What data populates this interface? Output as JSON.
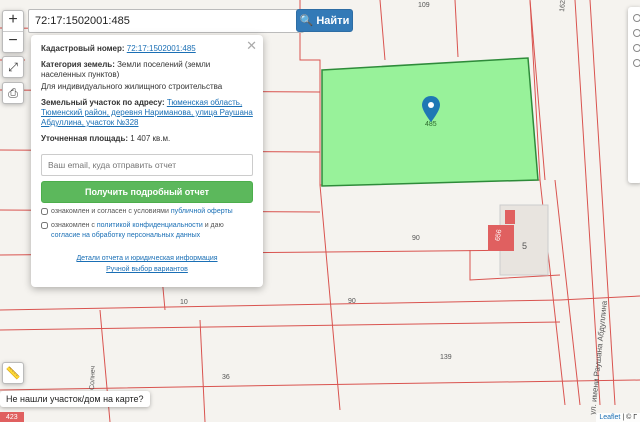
{
  "search": {
    "value": "72:17:1502001:485",
    "button_label": "Найти"
  },
  "zoom": {
    "in": "+",
    "out": "−"
  },
  "popup": {
    "cadastral_label": "Кадастровый номер:",
    "cadastral_value": "72:17:1502001:485",
    "category_label": "Категория земель:",
    "category_value": "Земли поселений (земли населенных пунктов)",
    "usage": "Для индивидуального жилищного строительства",
    "address_label": "Земельный участок по адресу:",
    "address_value": "Тюменская область, Тюменский район, деревня Нариманова, улица Раушана Абдуллина, участок №328",
    "area_label": "Уточненная площадь:",
    "area_value": "1 407 кв.м.",
    "email_placeholder": "Ваш email, куда отправить отчет",
    "report_button": "Получить подробный отчет",
    "consent1_text": "ознакомлен и согласен с условиями",
    "consent1_link": "публичной оферты",
    "consent2_text": "ознакомлен с",
    "consent2_link": "политикой конфиденциальности",
    "consent2_mid": "и даю",
    "consent2_link2": "согласие на обработку персональных данных",
    "details_link": "Детали отчета и юридическая информация",
    "manual_link": "Ручной выбор вариантов"
  },
  "map": {
    "labels": {
      "top": "109",
      "plot": "485",
      "road_top": "162/4",
      "n90a": "90",
      "n90b": "90",
      "n10": "10",
      "n139": "139",
      "n36": "36",
      "n5": "5",
      "n656": "656",
      "street": "ул. имени Раушана Абдуллина",
      "left_street": "Солнеч",
      "bottom_left": "423"
    },
    "colors": {
      "plot_fill": "#98f29a",
      "plot_stroke": "#2e8b3a",
      "lines": "#d9534f",
      "marker": "#1f78b4"
    }
  },
  "not_found": "Не нашли участок/дом на карте?",
  "attribution": {
    "leaflet": "Leaflet",
    "sep": " | © Г"
  }
}
